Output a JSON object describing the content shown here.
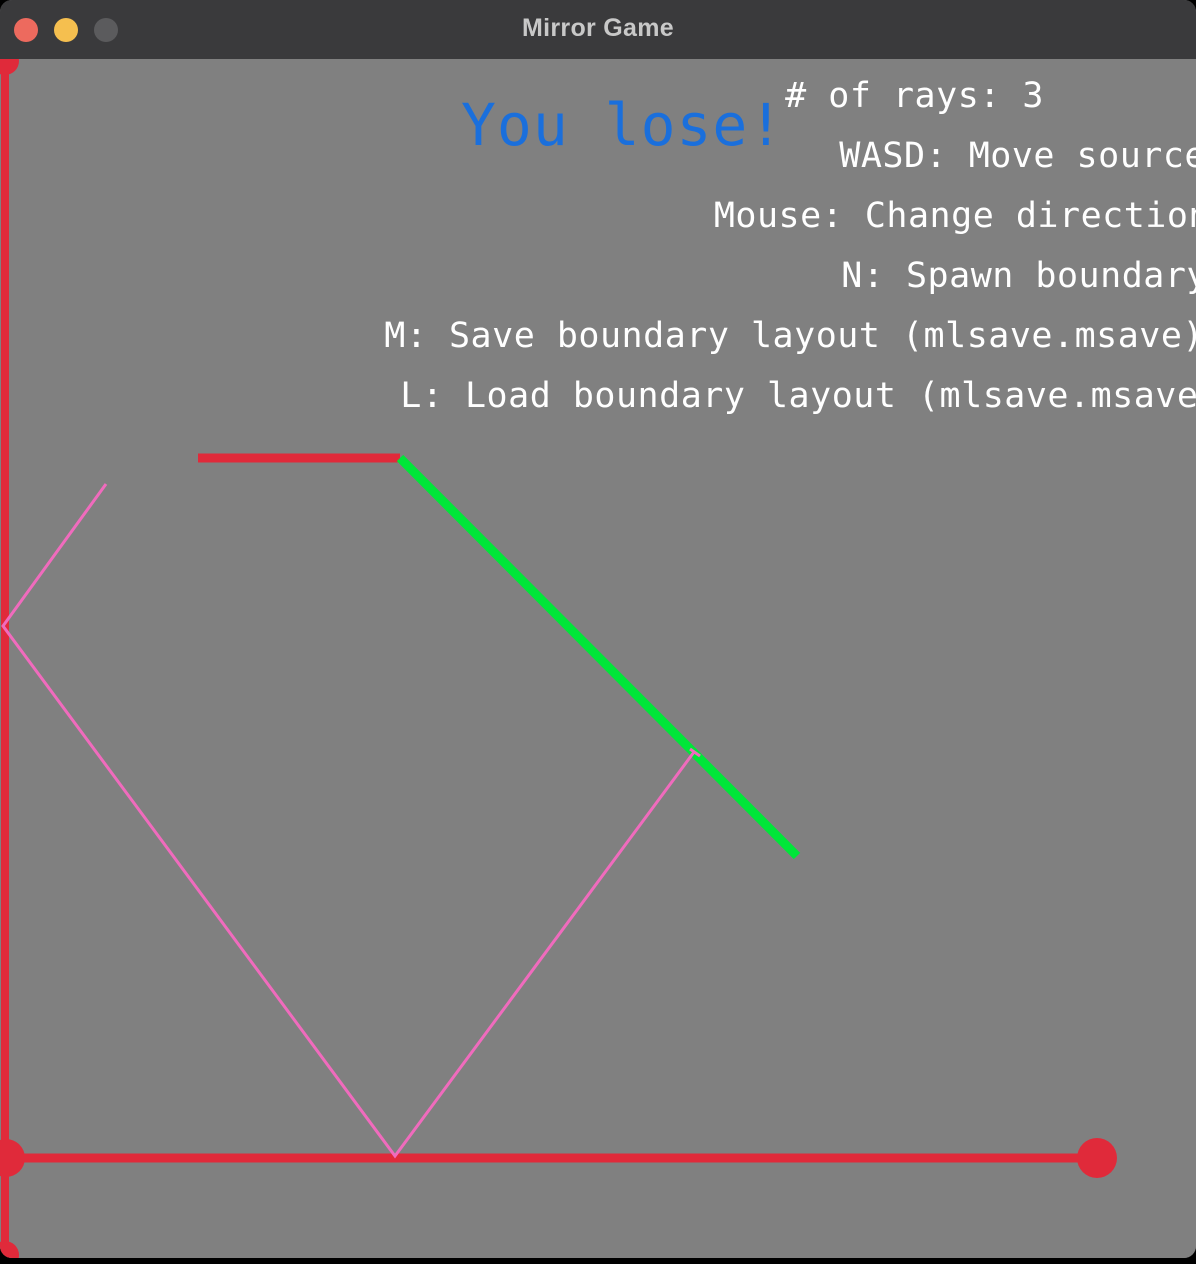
{
  "window": {
    "title": "Mirror Game"
  },
  "game": {
    "status_message": "You lose!",
    "hud": {
      "rays_label": "# of rays: 3",
      "controls": [
        "WASD: Move source",
        "Mouse: Change direction",
        "N: Spawn boundary",
        "M: Save boundary layout (mlsave.msave)",
        "L: Load boundary layout (mlsave.msave)"
      ]
    },
    "colors": {
      "background": "#808080",
      "boundary": "#e02a3a",
      "target_mirror": "#00e639",
      "ray": "#f06bbd",
      "lose_text": "#1a6fdc",
      "hud_text": "#ffffff"
    }
  }
}
